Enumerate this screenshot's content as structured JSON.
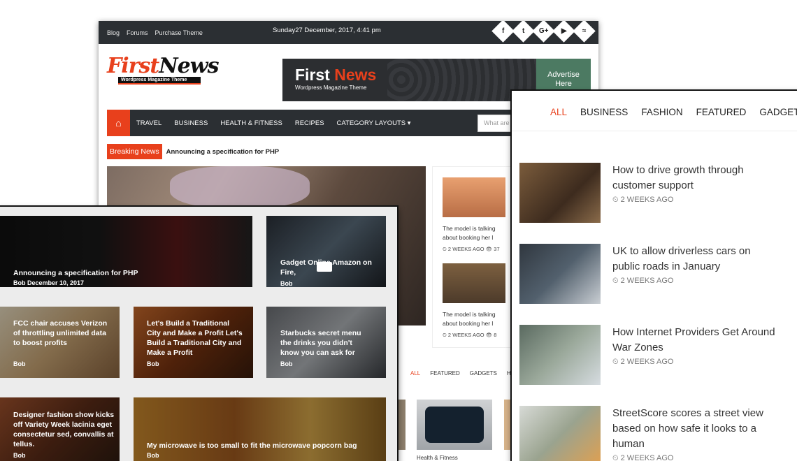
{
  "back": {
    "top_links": [
      "Blog",
      "Forums",
      "Purchase Theme"
    ],
    "date": "Sunday27 December, 2017, 4:41 pm",
    "socials": [
      "f",
      "t",
      "G+",
      "▶",
      "≈"
    ],
    "logo_first": "First",
    "logo_news": "News",
    "logo_sub": "Wordpress Magazine Theme",
    "ad_first": "First",
    "ad_news": "News",
    "ad_sub": "Wordpress Magazine Theme",
    "ad_button_line1": "Advertise",
    "ad_button_line2": "Here",
    "nav": [
      "TRAVEL",
      "BUSINESS",
      "HEALTH & FITNESS",
      "RECIPES",
      "CATEGORY LAYOUTS ▾"
    ],
    "search_placeholder": "What are you looking for?",
    "breaking_label": "Breaking News",
    "breaking_text": "Announcing a specification for PHP",
    "side": [
      {
        "text": "The model is talking about booking her l",
        "meta": "⏲ 2 WEEKS AGO   👁 37"
      },
      {
        "text": "The model is talking about booking her l",
        "meta": "⏲ 2 WEEKS AGO   👁 8"
      }
    ],
    "tabs2": [
      "ALL",
      "FEATURED",
      "GADGETS",
      "HEA"
    ],
    "watch_caption": "Health & Fitness"
  },
  "left": {
    "cards": [
      {
        "title": "Announcing a specification for PHP",
        "meta": "Bob December 10, 2017"
      },
      {
        "title": "Gadget Online Amazon on Fire,",
        "meta": "Bob"
      },
      {
        "title": "FCC chair accuses Verizon of throttling unlimited data to boost profits",
        "meta": "Bob"
      },
      {
        "title": "Let's Build a Traditional City and Make a Profit Let's Build a Traditional City and Make a Profit",
        "meta": "Bob"
      },
      {
        "title": "Starbucks secret menu the drinks you didn't know you can ask for",
        "meta": "Bob"
      },
      {
        "title": "Designer fashion show kicks off Variety Week lacinia eget consectetur sed, convallis at tellus.",
        "meta": "Bob"
      },
      {
        "title": "My microwave is too small to fit the microwave popcorn bag",
        "meta": "Bob"
      }
    ]
  },
  "right": {
    "tabs": [
      "ALL",
      "BUSINESS",
      "FASHION",
      "FEATURED",
      "GADGETS"
    ],
    "items": [
      {
        "title": "How to drive growth through customer support",
        "meta": "⏲ 2 WEEKS AGO"
      },
      {
        "title": "UK to allow driverless cars on public roads in January",
        "meta": "⏲ 2 WEEKS AGO"
      },
      {
        "title": "How Internet Providers Get Around War Zones",
        "meta": "⏲ 2 WEEKS AGO"
      },
      {
        "title": "StreetScore scores a street view based on how safe it looks to a human",
        "meta": "⏲ 2 WEEKS AGO"
      }
    ]
  },
  "colors": {
    "accent": "#e8401c",
    "dark": "#2b2f33"
  }
}
